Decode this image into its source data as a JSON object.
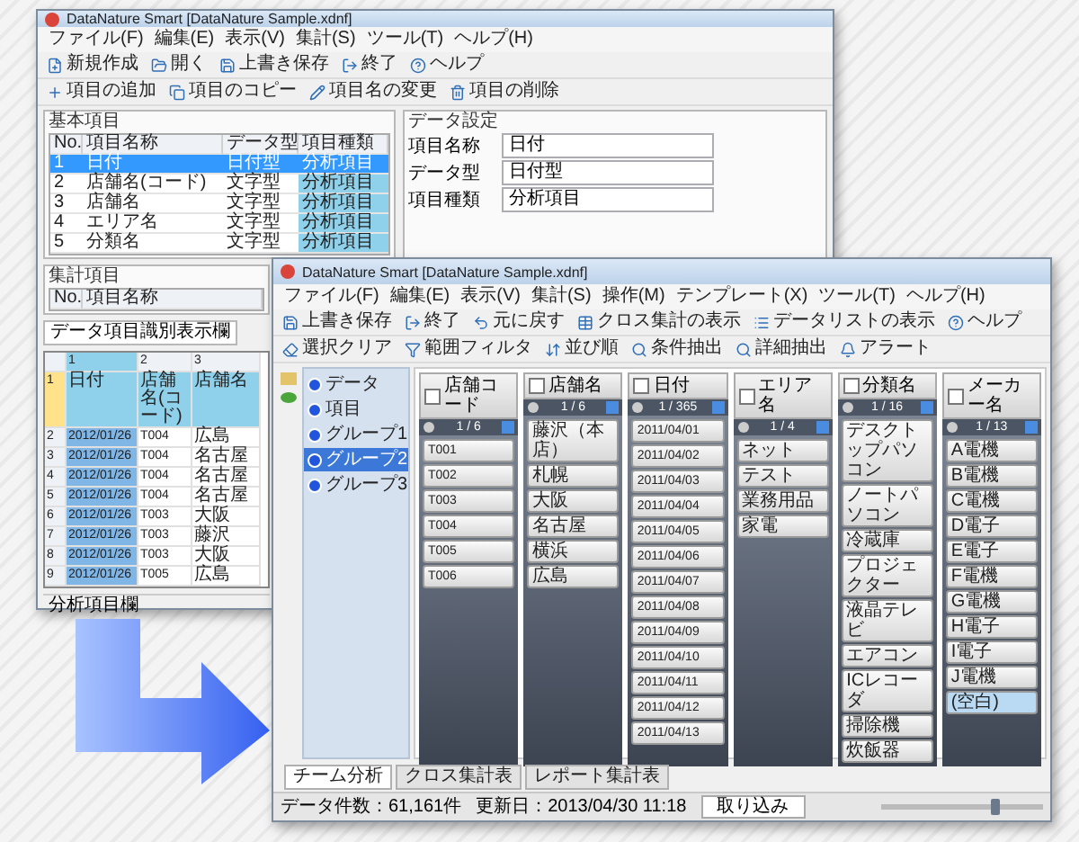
{
  "back_window": {
    "title": "DataNature Smart [DataNature Sample.xdnf]",
    "menu": [
      "ファイル(F)",
      "編集(E)",
      "表示(V)",
      "集計(S)",
      "ツール(T)",
      "ヘルプ(H)"
    ],
    "toolbar": [
      "新規作成",
      "開く",
      "上書き保存",
      "終了",
      "ヘルプ"
    ],
    "toolbar_2": [
      "項目の追加",
      "項目のコピー",
      "項目名の変更",
      "項目の削除"
    ],
    "item_panel": {
      "title": "基本項目",
      "columns": [
        "No.",
        "項目名称",
        "データ型",
        "項目種類"
      ],
      "rows": [
        {
          "cells": [
            "1",
            "日付",
            "日付型",
            "分析項目"
          ],
          "selected": true
        },
        {
          "cells": [
            "2",
            "店舗名(コード)",
            "文字型",
            "分析項目"
          ],
          "selected": false
        },
        {
          "cells": [
            "3",
            "店舗名",
            "文字型",
            "分析項目"
          ],
          "selected": false
        },
        {
          "cells": [
            "4",
            "エリア名",
            "文字型",
            "分析項目"
          ],
          "selected": false
        },
        {
          "cells": [
            "5",
            "分類名",
            "文字型",
            "分析項目"
          ],
          "selected": false
        }
      ]
    },
    "settings_panel": {
      "title": "データ設定",
      "fields": [
        {
          "label": "項目名称",
          "value": "日付"
        },
        {
          "label": "データ型",
          "value": "日付型"
        },
        {
          "label": "項目種類",
          "value": "分析項目"
        }
      ]
    },
    "summary_panel": {
      "title": "集計項目",
      "columns": [
        "No.",
        "項目名称"
      ]
    },
    "grid": {
      "tab": "データ項目識別表示欄",
      "columns": [
        "1",
        "2",
        "3"
      ],
      "rows": [
        {
          "header": "1",
          "cells": [
            "日付",
            "店舗名(コード)",
            "店舗名"
          ],
          "current": true
        },
        {
          "header": "2",
          "cells": [
            "2012/01/26",
            "T004",
            "広島"
          ],
          "current": false
        },
        {
          "header": "3",
          "cells": [
            "2012/01/26",
            "T004",
            "名古屋"
          ],
          "current": false
        },
        {
          "header": "4",
          "cells": [
            "2012/01/26",
            "T004",
            "名古屋"
          ],
          "current": false
        },
        {
          "header": "5",
          "cells": [
            "2012/01/26",
            "T004",
            "名古屋"
          ],
          "current": false
        },
        {
          "header": "6",
          "cells": [
            "2012/01/26",
            "T003",
            "大阪"
          ],
          "current": false
        },
        {
          "header": "7",
          "cells": [
            "2012/01/26",
            "T003",
            "藤沢"
          ],
          "current": false
        },
        {
          "header": "8",
          "cells": [
            "2012/01/26",
            "T003",
            "大阪"
          ],
          "current": false
        },
        {
          "header": "9",
          "cells": [
            "2012/01/26",
            "T005",
            "広島"
          ],
          "current": false
        }
      ]
    },
    "status": "分析項目欄"
  },
  "front_window": {
    "title": "DataNature Smart [DataNature Sample.xdnf]",
    "menu": [
      "ファイル(F)",
      "編集(E)",
      "表示(V)",
      "集計(S)",
      "操作(M)",
      "テンプレート(X)",
      "ツール(T)",
      "ヘルプ(H)"
    ],
    "toolbar": [
      "上書き保存",
      "終了",
      "元に戻す",
      "クロス集計の表示",
      "データリストの表示",
      "ヘルプ"
    ],
    "toolbar_2": [
      "選択クリア",
      "範囲フィルタ",
      "並び順",
      "条件抽出",
      "詳細抽出",
      "アラート"
    ],
    "tree": [
      {
        "label": "データ",
        "selected": false
      },
      {
        "label": "項目",
        "selected": false
      },
      {
        "label": "グループ1",
        "selected": false
      },
      {
        "label": "グループ2",
        "selected": true
      },
      {
        "label": "グループ3",
        "selected": false
      }
    ],
    "columns": [
      {
        "label": "店舗コード",
        "checked": false,
        "count": "1 / 6",
        "items": [
          {
            "label": "T001",
            "selected": false
          },
          {
            "label": "T002",
            "selected": false
          },
          {
            "label": "T003",
            "selected": false
          },
          {
            "label": "T004",
            "selected": false
          },
          {
            "label": "T005",
            "selected": false
          },
          {
            "label": "T006",
            "selected": false
          }
        ]
      },
      {
        "label": "店舗名",
        "checked": false,
        "count": "1 / 6",
        "items": [
          {
            "label": "藤沢（本店）",
            "selected": false
          },
          {
            "label": "札幌",
            "selected": false
          },
          {
            "label": "大阪",
            "selected": false
          },
          {
            "label": "名古屋",
            "selected": false
          },
          {
            "label": "横浜",
            "selected": false
          },
          {
            "label": "広島",
            "selected": false
          }
        ]
      },
      {
        "label": "日付",
        "checked": false,
        "count": "1 / 365",
        "items": [
          {
            "label": "2011/04/01",
            "selected": false
          },
          {
            "label": "2011/04/02",
            "selected": false
          },
          {
            "label": "2011/04/03",
            "selected": false
          },
          {
            "label": "2011/04/04",
            "selected": false
          },
          {
            "label": "2011/04/05",
            "selected": false
          },
          {
            "label": "2011/04/06",
            "selected": false
          },
          {
            "label": "2011/04/07",
            "selected": false
          },
          {
            "label": "2011/04/08",
            "selected": false
          },
          {
            "label": "2011/04/09",
            "selected": false
          },
          {
            "label": "2011/04/10",
            "selected": false
          },
          {
            "label": "2011/04/11",
            "selected": false
          },
          {
            "label": "2011/04/12",
            "selected": false
          },
          {
            "label": "2011/04/13",
            "selected": false
          }
        ]
      },
      {
        "label": "エリア名",
        "checked": false,
        "count": "1 / 4",
        "items": [
          {
            "label": "ネット",
            "selected": false
          },
          {
            "label": "テスト",
            "selected": false
          },
          {
            "label": "業務用品",
            "selected": false
          },
          {
            "label": "家電",
            "selected": false
          }
        ]
      },
      {
        "label": "分類名",
        "checked": false,
        "count": "1 / 16",
        "items": [
          {
            "label": "デスクトップパソコン",
            "selected": false
          },
          {
            "label": "ノートパソコン",
            "selected": false
          },
          {
            "label": "冷蔵庫",
            "selected": false
          },
          {
            "label": "プロジェクター",
            "selected": false
          },
          {
            "label": "液晶テレビ",
            "selected": false
          },
          {
            "label": "エアコン",
            "selected": false
          },
          {
            "label": "ICレコーダ",
            "selected": false
          },
          {
            "label": "掃除機",
            "selected": false
          },
          {
            "label": "炊飯器",
            "selected": false
          }
        ]
      },
      {
        "label": "メーカー名",
        "checked": false,
        "count": "1 / 13",
        "items": [
          {
            "label": "A電機",
            "selected": false
          },
          {
            "label": "B電機",
            "selected": false
          },
          {
            "label": "C電機",
            "selected": false
          },
          {
            "label": "D電子",
            "selected": false
          },
          {
            "label": "E電子",
            "selected": false
          },
          {
            "label": "F電機",
            "selected": false
          },
          {
            "label": "G電機",
            "selected": false
          },
          {
            "label": "H電子",
            "selected": false
          },
          {
            "label": "I電子",
            "selected": false
          },
          {
            "label": "J電機",
            "selected": false
          },
          {
            "label": "(空白)",
            "selected": true
          }
        ]
      }
    ],
    "tabs": [
      {
        "label": "チーム分析",
        "selected": true
      },
      {
        "label": "クロス集計表",
        "selected": false
      },
      {
        "label": "レポート集計表",
        "selected": false
      }
    ],
    "status": {
      "count": "データ件数：61,161件",
      "updated": "更新日：2013/04/30 11:18",
      "button": "取り込み"
    },
    "zoom": {
      "level": 0.7
    }
  }
}
